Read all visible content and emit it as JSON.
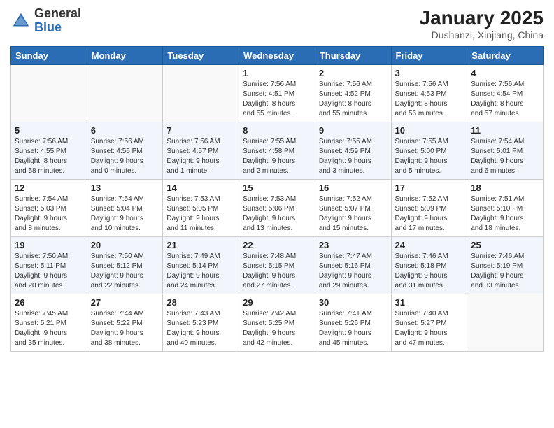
{
  "header": {
    "logo_general": "General",
    "logo_blue": "Blue",
    "title": "January 2025",
    "location": "Dushanzi, Xinjiang, China"
  },
  "days_of_week": [
    "Sunday",
    "Monday",
    "Tuesday",
    "Wednesday",
    "Thursday",
    "Friday",
    "Saturday"
  ],
  "weeks": [
    [
      {
        "day": "",
        "info": ""
      },
      {
        "day": "",
        "info": ""
      },
      {
        "day": "",
        "info": ""
      },
      {
        "day": "1",
        "info": "Sunrise: 7:56 AM\nSunset: 4:51 PM\nDaylight: 8 hours\nand 55 minutes."
      },
      {
        "day": "2",
        "info": "Sunrise: 7:56 AM\nSunset: 4:52 PM\nDaylight: 8 hours\nand 55 minutes."
      },
      {
        "day": "3",
        "info": "Sunrise: 7:56 AM\nSunset: 4:53 PM\nDaylight: 8 hours\nand 56 minutes."
      },
      {
        "day": "4",
        "info": "Sunrise: 7:56 AM\nSunset: 4:54 PM\nDaylight: 8 hours\nand 57 minutes."
      }
    ],
    [
      {
        "day": "5",
        "info": "Sunrise: 7:56 AM\nSunset: 4:55 PM\nDaylight: 8 hours\nand 58 minutes."
      },
      {
        "day": "6",
        "info": "Sunrise: 7:56 AM\nSunset: 4:56 PM\nDaylight: 9 hours\nand 0 minutes."
      },
      {
        "day": "7",
        "info": "Sunrise: 7:56 AM\nSunset: 4:57 PM\nDaylight: 9 hours\nand 1 minute."
      },
      {
        "day": "8",
        "info": "Sunrise: 7:55 AM\nSunset: 4:58 PM\nDaylight: 9 hours\nand 2 minutes."
      },
      {
        "day": "9",
        "info": "Sunrise: 7:55 AM\nSunset: 4:59 PM\nDaylight: 9 hours\nand 3 minutes."
      },
      {
        "day": "10",
        "info": "Sunrise: 7:55 AM\nSunset: 5:00 PM\nDaylight: 9 hours\nand 5 minutes."
      },
      {
        "day": "11",
        "info": "Sunrise: 7:54 AM\nSunset: 5:01 PM\nDaylight: 9 hours\nand 6 minutes."
      }
    ],
    [
      {
        "day": "12",
        "info": "Sunrise: 7:54 AM\nSunset: 5:03 PM\nDaylight: 9 hours\nand 8 minutes."
      },
      {
        "day": "13",
        "info": "Sunrise: 7:54 AM\nSunset: 5:04 PM\nDaylight: 9 hours\nand 10 minutes."
      },
      {
        "day": "14",
        "info": "Sunrise: 7:53 AM\nSunset: 5:05 PM\nDaylight: 9 hours\nand 11 minutes."
      },
      {
        "day": "15",
        "info": "Sunrise: 7:53 AM\nSunset: 5:06 PM\nDaylight: 9 hours\nand 13 minutes."
      },
      {
        "day": "16",
        "info": "Sunrise: 7:52 AM\nSunset: 5:07 PM\nDaylight: 9 hours\nand 15 minutes."
      },
      {
        "day": "17",
        "info": "Sunrise: 7:52 AM\nSunset: 5:09 PM\nDaylight: 9 hours\nand 17 minutes."
      },
      {
        "day": "18",
        "info": "Sunrise: 7:51 AM\nSunset: 5:10 PM\nDaylight: 9 hours\nand 18 minutes."
      }
    ],
    [
      {
        "day": "19",
        "info": "Sunrise: 7:50 AM\nSunset: 5:11 PM\nDaylight: 9 hours\nand 20 minutes."
      },
      {
        "day": "20",
        "info": "Sunrise: 7:50 AM\nSunset: 5:12 PM\nDaylight: 9 hours\nand 22 minutes."
      },
      {
        "day": "21",
        "info": "Sunrise: 7:49 AM\nSunset: 5:14 PM\nDaylight: 9 hours\nand 24 minutes."
      },
      {
        "day": "22",
        "info": "Sunrise: 7:48 AM\nSunset: 5:15 PM\nDaylight: 9 hours\nand 27 minutes."
      },
      {
        "day": "23",
        "info": "Sunrise: 7:47 AM\nSunset: 5:16 PM\nDaylight: 9 hours\nand 29 minutes."
      },
      {
        "day": "24",
        "info": "Sunrise: 7:46 AM\nSunset: 5:18 PM\nDaylight: 9 hours\nand 31 minutes."
      },
      {
        "day": "25",
        "info": "Sunrise: 7:46 AM\nSunset: 5:19 PM\nDaylight: 9 hours\nand 33 minutes."
      }
    ],
    [
      {
        "day": "26",
        "info": "Sunrise: 7:45 AM\nSunset: 5:21 PM\nDaylight: 9 hours\nand 35 minutes."
      },
      {
        "day": "27",
        "info": "Sunrise: 7:44 AM\nSunset: 5:22 PM\nDaylight: 9 hours\nand 38 minutes."
      },
      {
        "day": "28",
        "info": "Sunrise: 7:43 AM\nSunset: 5:23 PM\nDaylight: 9 hours\nand 40 minutes."
      },
      {
        "day": "29",
        "info": "Sunrise: 7:42 AM\nSunset: 5:25 PM\nDaylight: 9 hours\nand 42 minutes."
      },
      {
        "day": "30",
        "info": "Sunrise: 7:41 AM\nSunset: 5:26 PM\nDaylight: 9 hours\nand 45 minutes."
      },
      {
        "day": "31",
        "info": "Sunrise: 7:40 AM\nSunset: 5:27 PM\nDaylight: 9 hours\nand 47 minutes."
      },
      {
        "day": "",
        "info": ""
      }
    ]
  ]
}
